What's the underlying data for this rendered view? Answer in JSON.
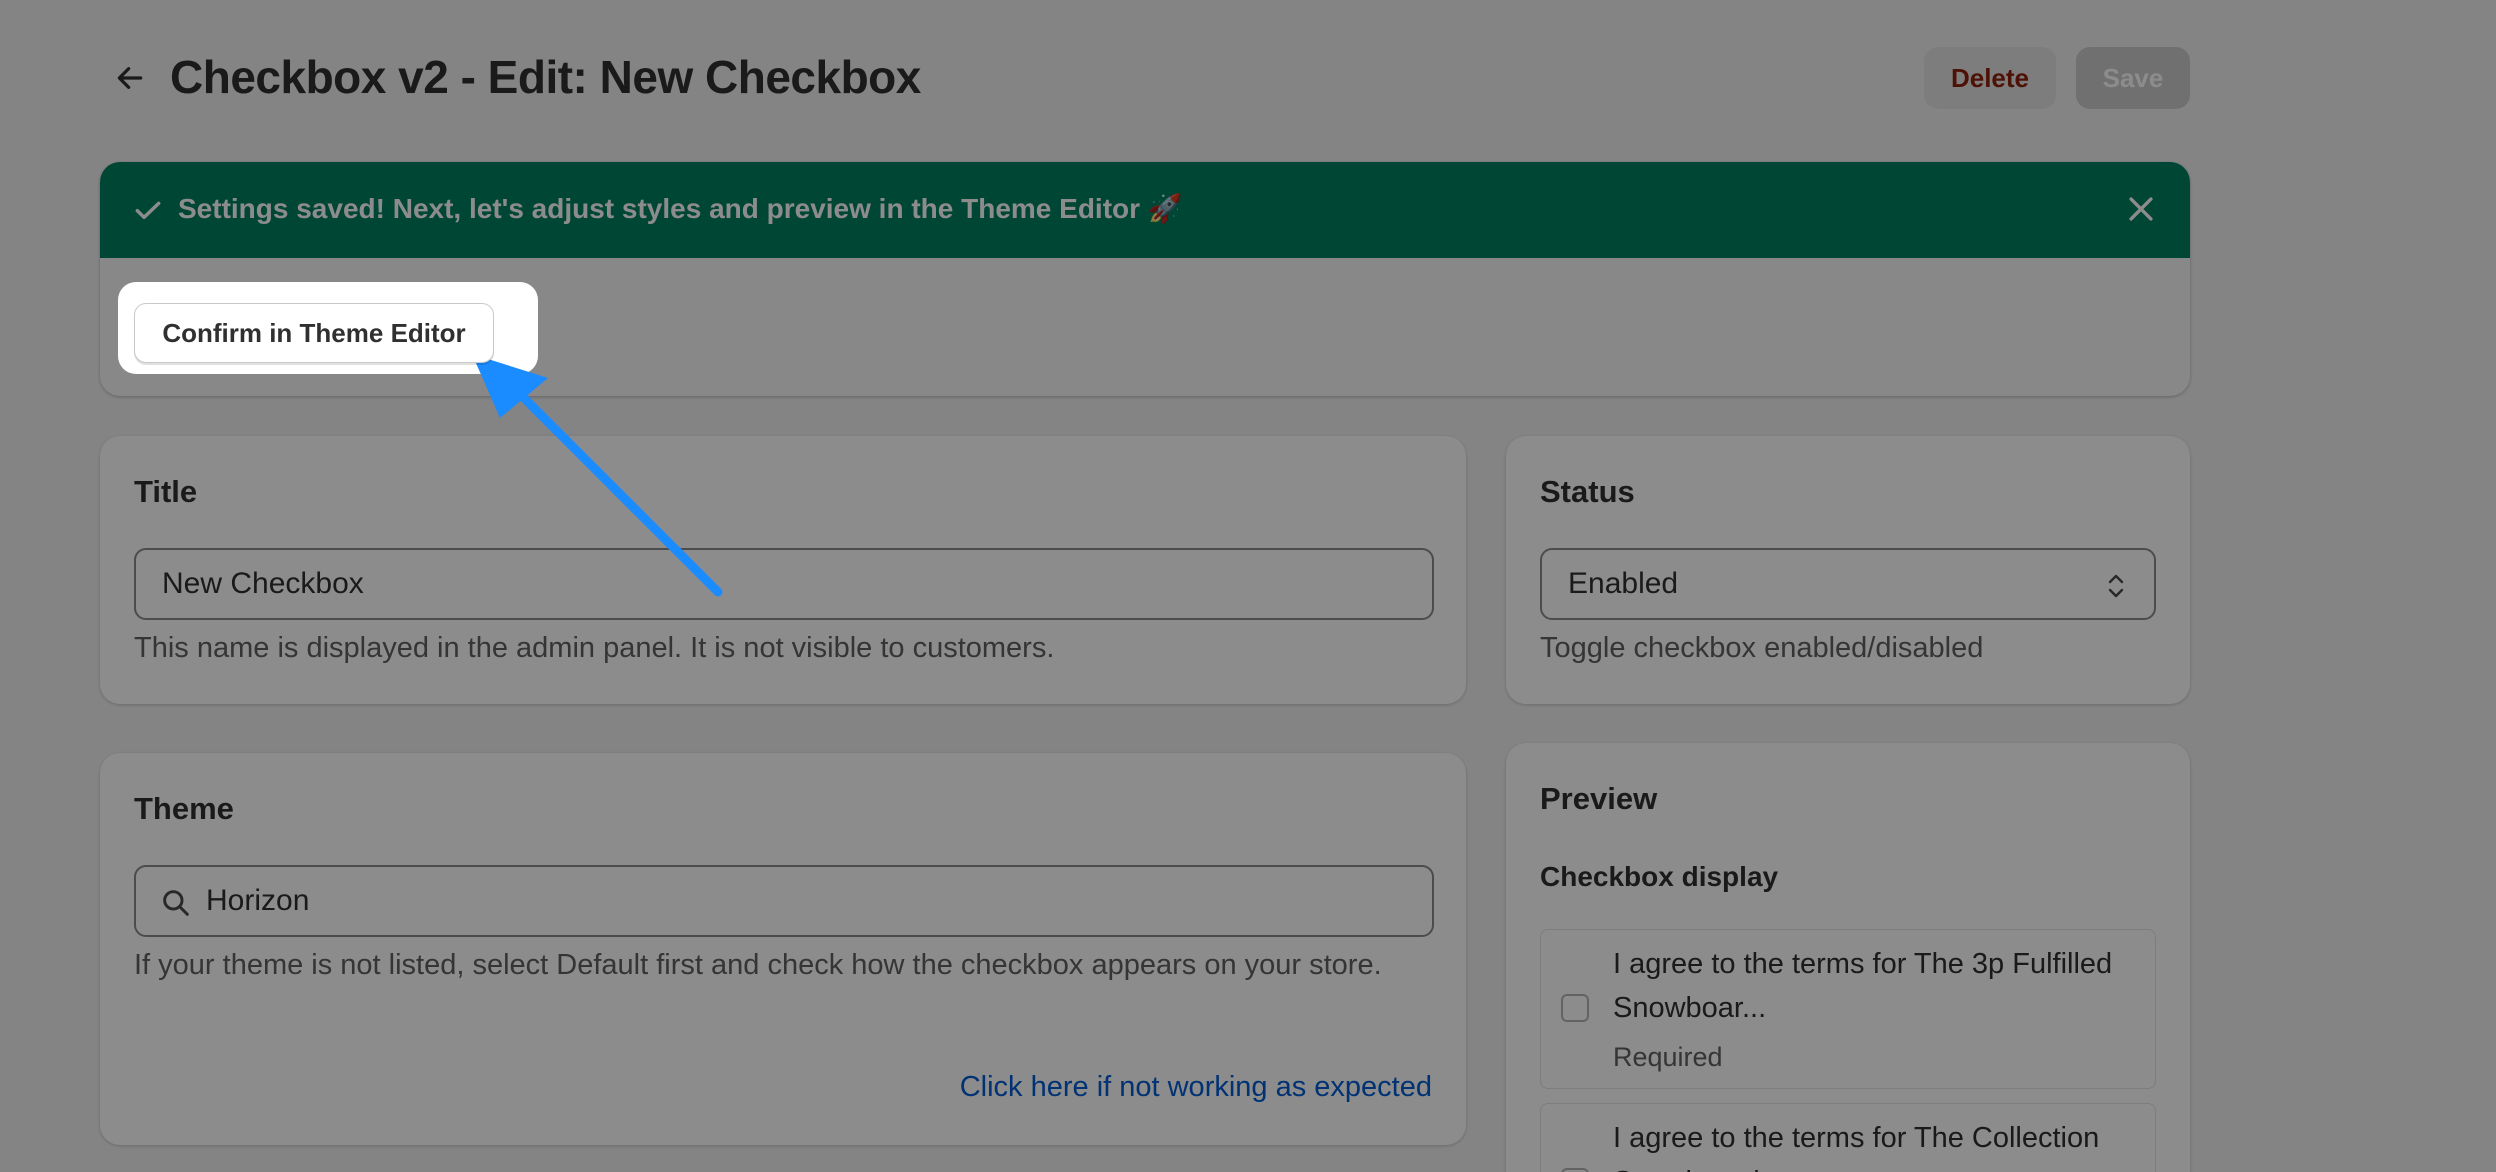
{
  "header": {
    "title": "Checkbox v2 - Edit: New Checkbox",
    "back_icon": "arrow-left-icon",
    "delete_label": "Delete",
    "save_label": "Save"
  },
  "banner": {
    "message": "Settings saved! Next, let's adjust styles and preview in the Theme Editor 🚀",
    "confirm_label": "Confirm in Theme Editor",
    "bg_color": "#008060"
  },
  "title_card": {
    "heading": "Title",
    "value": "New Checkbox",
    "help": "This name is displayed in the admin panel. It is not visible to customers."
  },
  "status_card": {
    "heading": "Status",
    "value": "Enabled",
    "help": "Toggle checkbox enabled/disabled"
  },
  "theme_card": {
    "heading": "Theme",
    "value": "Horizon",
    "help": "If your theme is not listed, select Default first and check how the checkbox appears on your store.",
    "link": "Click here if not working as expected"
  },
  "preview_card": {
    "heading": "Preview",
    "subheading": "Checkbox display",
    "items": [
      {
        "label": "I agree to the terms for The 3p Fulfilled Snowboar...",
        "sub": "Required"
      },
      {
        "label": "I agree to the terms for The Collection Snowboard..."
      }
    ]
  },
  "colors": {
    "accent_link": "#005bd3",
    "annotation_arrow": "#1a8cff",
    "delete_text": "#8e1f0b"
  }
}
